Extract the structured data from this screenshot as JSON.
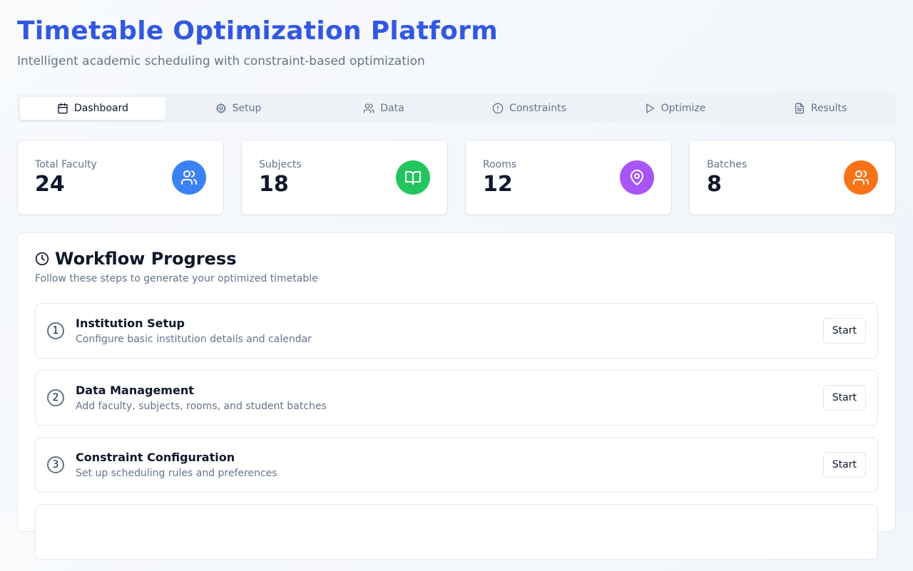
{
  "header": {
    "title": "Timetable Optimization Platform",
    "subtitle": "Intelligent academic scheduling with constraint-based optimization"
  },
  "tabs": [
    {
      "label": "Dashboard",
      "icon": "calendar-icon",
      "active": true
    },
    {
      "label": "Setup",
      "icon": "gear-icon",
      "active": false
    },
    {
      "label": "Data",
      "icon": "users-icon",
      "active": false
    },
    {
      "label": "Constraints",
      "icon": "alert-circle-icon",
      "active": false
    },
    {
      "label": "Optimize",
      "icon": "play-icon",
      "active": false
    },
    {
      "label": "Results",
      "icon": "document-icon",
      "active": false
    }
  ],
  "stats": [
    {
      "label": "Total Faculty",
      "value": "24",
      "icon": "users-icon",
      "color": "#3b82f6"
    },
    {
      "label": "Subjects",
      "value": "18",
      "icon": "book-open-icon",
      "color": "#22c55e"
    },
    {
      "label": "Rooms",
      "value": "12",
      "icon": "map-pin-icon",
      "color": "#a855f7"
    },
    {
      "label": "Batches",
      "value": "8",
      "icon": "users-icon",
      "color": "#f97316"
    }
  ],
  "workflow": {
    "title": "Workflow Progress",
    "description": "Follow these steps to generate your optimized timetable",
    "steps": [
      {
        "number": "1",
        "title": "Institution Setup",
        "description": "Configure basic institution details and calendar",
        "button": "Start"
      },
      {
        "number": "2",
        "title": "Data Management",
        "description": "Add faculty, subjects, rooms, and student batches",
        "button": "Start"
      },
      {
        "number": "3",
        "title": "Constraint Configuration",
        "description": "Set up scheduling rules and preferences",
        "button": "Start"
      },
      {
        "number": "",
        "title": "",
        "description": "",
        "button": ""
      }
    ]
  },
  "colors": {
    "accent": "#3358e0",
    "muted_text": "#64748b"
  }
}
